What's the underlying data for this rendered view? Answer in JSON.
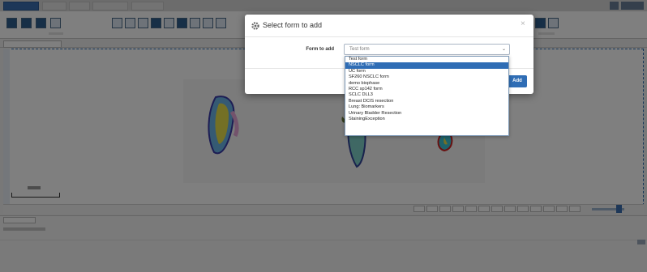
{
  "colors": {
    "accent": "#2f6db5",
    "overlay": "rgba(0,0,0,0.5)"
  },
  "icons": {
    "modal_title_icon": "gear-icon",
    "modal_close_icon": "close-icon",
    "select_caret_icon": "chevron-down-icon"
  },
  "modal": {
    "title": "Select form to add",
    "close_label": "×",
    "form_label": "Form to add",
    "selected_value": "Test form",
    "select_caret": "⌄",
    "add_label": "Add",
    "options": [
      "Test form",
      "NSCLC form",
      "UC form",
      "SF260 NSCLC form",
      "demo biophase",
      "RCC sp142 form",
      "SCLC DLL3",
      "Breast DCIS resection",
      "Lung: Biomarkers",
      "Urinary Bladder Resection",
      "StainingException"
    ],
    "highlighted_index": 1
  }
}
